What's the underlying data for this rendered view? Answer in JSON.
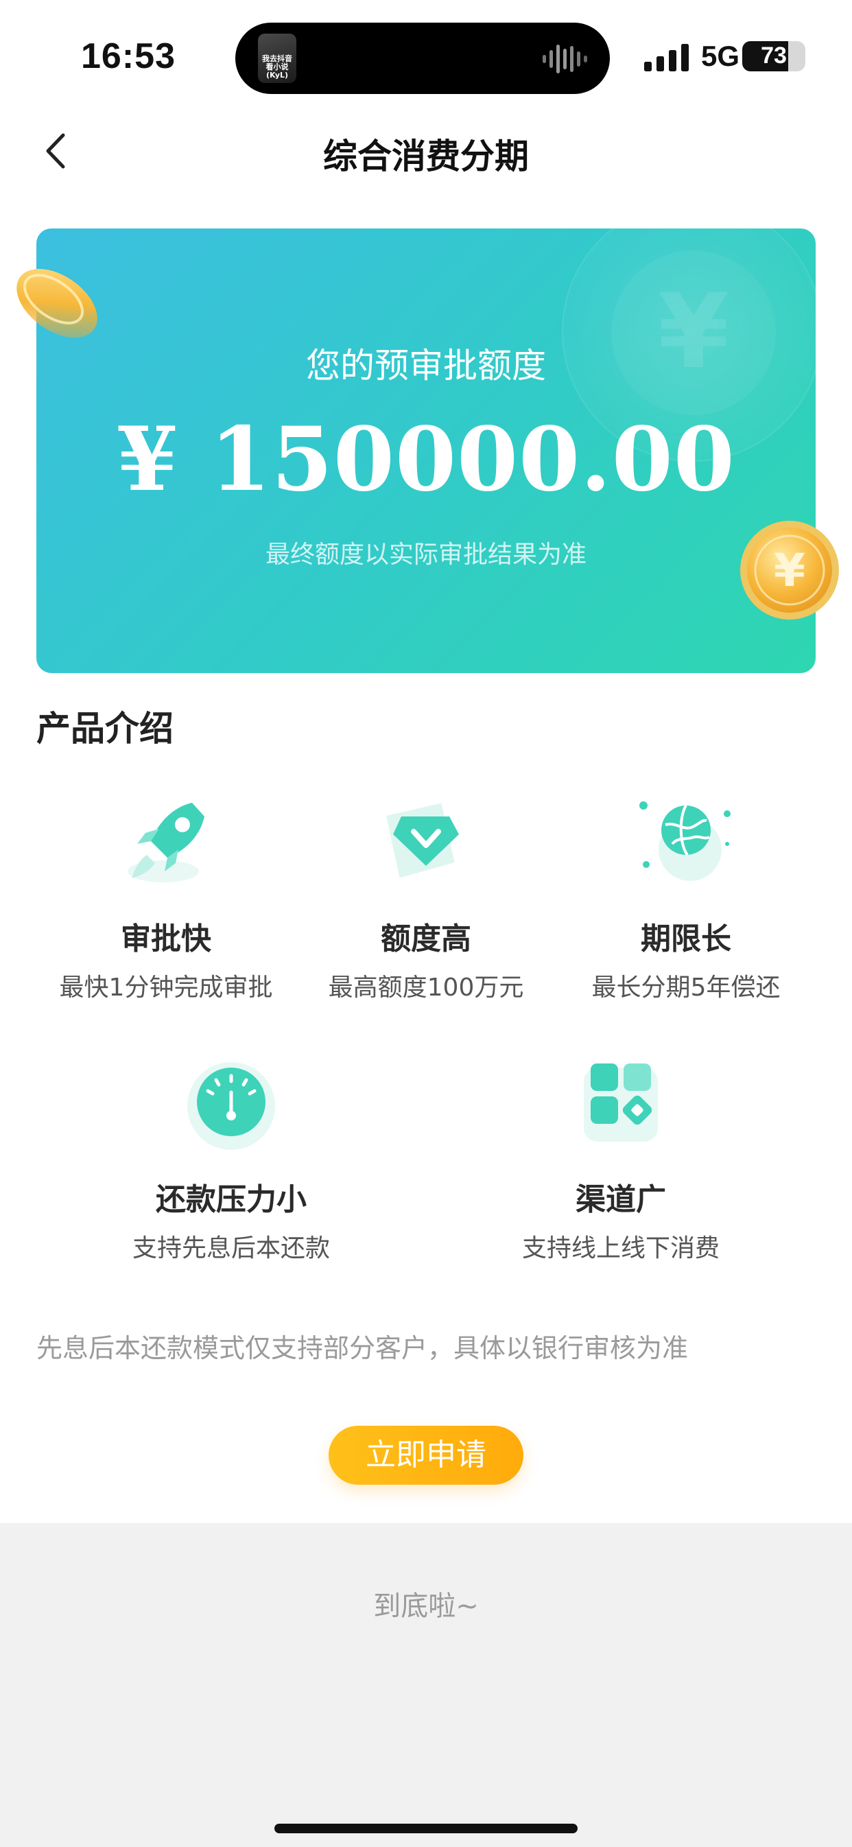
{
  "status_bar": {
    "time": "16:53",
    "island_thumb_text": "我去抖音看小说(KyL)",
    "network": "5G",
    "battery_percent": 73,
    "battery_label": "73"
  },
  "nav": {
    "title": "综合消费分期",
    "back_icon": "chevron-left-icon"
  },
  "hero": {
    "label": "您的预审批额度",
    "amount": "¥ 150000.00",
    "note": "最终额度以实际审批结果为准"
  },
  "product_section": {
    "title": "产品介绍",
    "features": [
      {
        "icon": "rocket-icon",
        "title": "审批快",
        "desc": "最快1分钟完成审批"
      },
      {
        "icon": "diamond-icon",
        "title": "额度高",
        "desc": "最高额度100万元"
      },
      {
        "icon": "globe-icon",
        "title": "期限长",
        "desc": "最长分期5年偿还"
      },
      {
        "icon": "gauge-icon",
        "title": "还款压力小",
        "desc": "支持先息后本还款"
      },
      {
        "icon": "apps-grid-icon",
        "title": "渠道广",
        "desc": "支持线上线下消费"
      }
    ],
    "disclaimer": "先息后本还款模式仅支持部分客户，具体以银行审核为准"
  },
  "apply_button": {
    "label": "立即申请"
  },
  "footer": {
    "text": "到底啦~"
  },
  "colors": {
    "hero_start": "#3cbfe0",
    "hero_end": "#2ed6b1",
    "accent_teal": "#2fcdb7",
    "button_orange": "#ffb311",
    "coin_gold": "#f6b83a"
  }
}
